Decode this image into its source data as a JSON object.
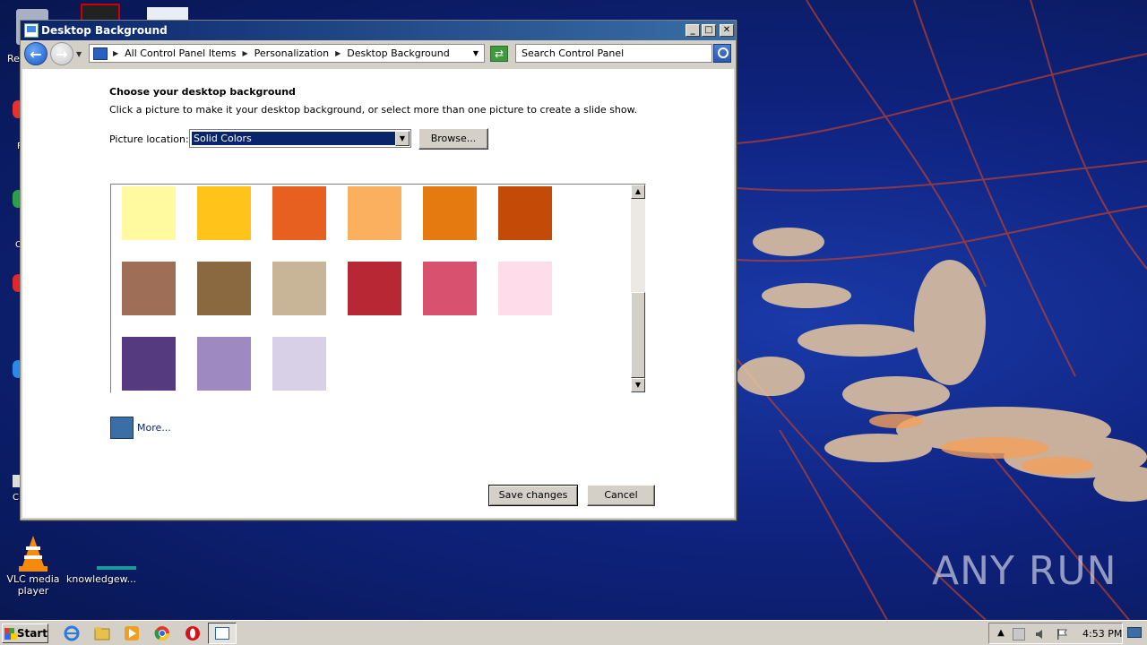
{
  "desktop": {
    "watermark": "ANY RUN",
    "icons": [
      {
        "label": "VLC media player",
        "icon": "vlc-cone-icon"
      },
      {
        "label": "knowledgew...",
        "icon": "file-icon"
      }
    ],
    "edge_labels": [
      "Re",
      "F",
      "C",
      "C"
    ]
  },
  "window": {
    "title": "Desktop Background",
    "controls": {
      "minimize": "_",
      "maximize": "□",
      "close": "✕"
    },
    "nav": {
      "breadcrumb": [
        "All Control Panel Items",
        "Personalization",
        "Desktop Background"
      ],
      "search_placeholder": "Search Control Panel"
    },
    "content": {
      "heading": "Choose your desktop background",
      "description": "Click a picture to make it your desktop background, or select more than one picture to create a slide show.",
      "location_label": "Picture location:",
      "location_value": "Solid Colors",
      "browse_label": "Browse...",
      "more_label": "More...",
      "more_color": "#3a6ea5",
      "save_label": "Save changes",
      "cancel_label": "Cancel"
    },
    "swatches": [
      "#fff9a0",
      "#ffc31a",
      "#e86020",
      "#fbb060",
      "#e47a10",
      "#c44a08",
      "#9e6e56",
      "#8a6840",
      "#c8b496",
      "#b82834",
      "#d85270",
      "#ffdcea",
      "#553a80",
      "#9e8ac0",
      "#d8d0e6"
    ]
  },
  "taskbar": {
    "start_label": "Start",
    "pinned": [
      "ie-icon",
      "explorer-folder-icon",
      "media-player-icon",
      "chrome-icon",
      "opera-icon",
      "control-panel-icon"
    ],
    "clock": "4:53 PM"
  }
}
